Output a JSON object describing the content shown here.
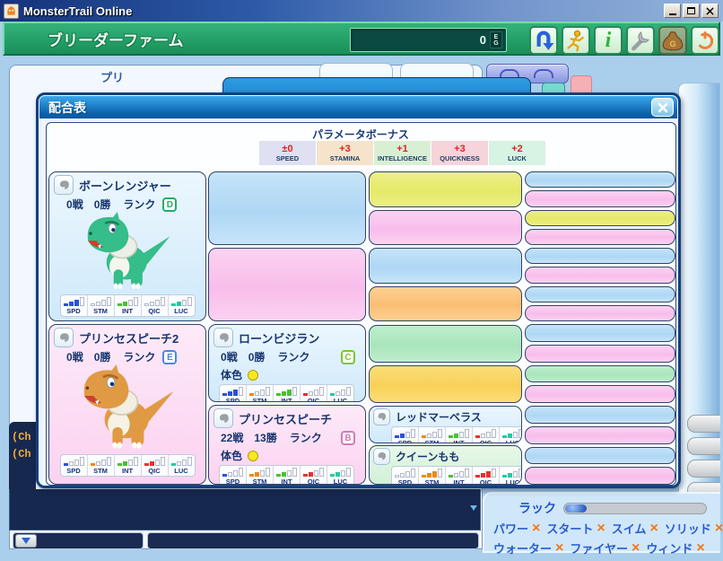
{
  "window": {
    "title": "MonsterTrail Online"
  },
  "toolbar": {
    "farm_label": "ブリーダーファーム",
    "money_value": "0",
    "money_unit_top": "E",
    "money_unit_bottom": "G",
    "info_glyph": "i",
    "bag_letter": "G"
  },
  "background": {
    "partial_label": "プリ",
    "chat": {
      "line1": "(Ch",
      "line2": "(Ch"
    },
    "luck": {
      "label": "ラック",
      "cross": "×",
      "row1": [
        {
          "label": "パワー"
        },
        {
          "label": "スタート"
        },
        {
          "label": "スイム"
        },
        {
          "label": "ソリッド"
        }
      ],
      "row2": [
        {
          "label": "ウォーター"
        },
        {
          "label": "ファイヤー"
        },
        {
          "label": "ウィンド"
        }
      ]
    }
  },
  "dialog": {
    "title": "配合表",
    "bonus": {
      "label": "パラメータボーナス",
      "items": [
        {
          "value": "±0",
          "label": "SPEED",
          "bg": "#dfe0f2"
        },
        {
          "value": "+3",
          "label": "STAMINA",
          "bg": "#f6e3cb"
        },
        {
          "value": "+1",
          "label": "INTELLIGENCE",
          "bg": "#d9efd4"
        },
        {
          "value": "+3",
          "label": "QUICKNESS",
          "bg": "#f7d3da"
        },
        {
          "value": "+2",
          "label": "LUCK",
          "bg": "#d7f3e3"
        }
      ]
    },
    "labels": {
      "battle": "戦",
      "win": "勝",
      "rank": "ランク",
      "body_color": "体色"
    },
    "stat_labels": [
      "SPD",
      "STM",
      "INT",
      "QIC",
      "LUC"
    ],
    "stat_colors": [
      "#2a50e0",
      "#f08818",
      "#48c030",
      "#e83030",
      "#28c8a0"
    ],
    "monsters": [
      {
        "name": "ボーンレンジャー",
        "battles": "0",
        "wins": "0",
        "rank": "D",
        "rank_color": "#2aa868",
        "stats": [
          3,
          0,
          2,
          0,
          2
        ]
      },
      {
        "name": "プリンセスピーチ2",
        "battles": "0",
        "wins": "0",
        "rank": "E",
        "rank_color": "#4a86e8",
        "stats": [
          1,
          1,
          2,
          2,
          1
        ]
      },
      {
        "name": "ローンビジラン",
        "battles": "0",
        "wins": "0",
        "rank": "C",
        "rank_color": "#7ac828",
        "stats": [
          3,
          1,
          3,
          1,
          1
        ],
        "body_color": "#f8e820"
      },
      {
        "name": "プリンセスピーチ",
        "battles": "22",
        "wins": "13",
        "rank": "B",
        "rank_color": "#d878b8",
        "stats": [
          1,
          2,
          2,
          2,
          2
        ],
        "body_color": "#f8e820"
      },
      {
        "name": "レッドマーベラス",
        "stats": [
          2,
          1,
          2,
          1,
          2
        ]
      },
      {
        "name": "クイーンもも",
        "stats": [
          0,
          3,
          1,
          3,
          2
        ]
      }
    ],
    "grid": {
      "palette": {
        "blue": [
          "#c6e4f9",
          "#aed7f5"
        ],
        "pink": [
          "#fbd2f1",
          "#f8bdeb"
        ],
        "yellow": [
          "#ecef8a",
          "#e5e968"
        ],
        "orange": [
          "#fdd093",
          "#fbbe74"
        ],
        "green": [
          "#bfeecd",
          "#a9e5bc"
        ],
        "gold": [
          "#fbdd7a",
          "#f8d158"
        ]
      },
      "col2_top": [
        "blue",
        "pink"
      ],
      "col3_top": [
        "yellow",
        "pink",
        "blue",
        "orange"
      ],
      "col4_top": [
        "blue",
        "pink",
        "yellow",
        "pink",
        "blue",
        "pink",
        "blue",
        "pink"
      ],
      "col3_bottom": [
        "green",
        "gold"
      ],
      "col4_bottom": [
        "blue",
        "pink",
        "green",
        "pink",
        "blue",
        "pink",
        "blue",
        "pink"
      ]
    }
  }
}
